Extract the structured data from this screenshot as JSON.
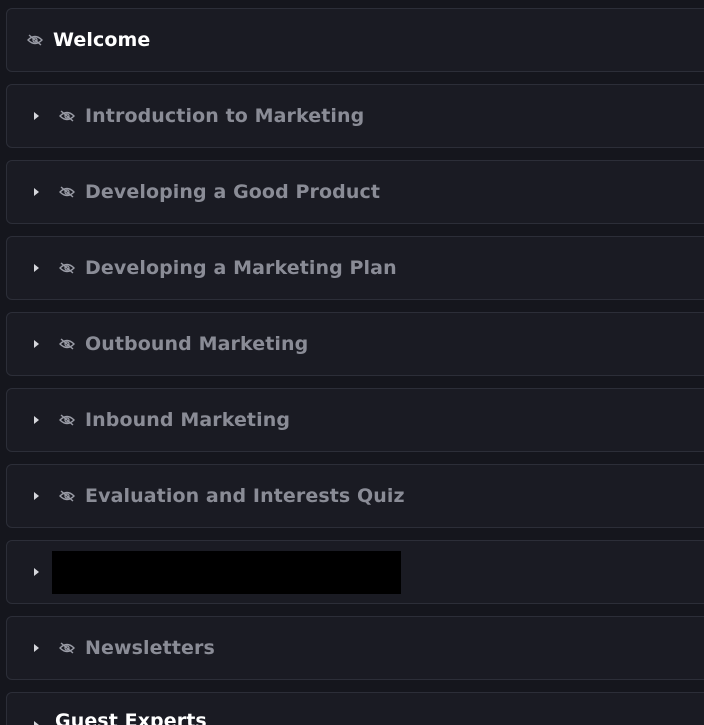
{
  "modules": [
    {
      "label": "Welcome",
      "expandable": false,
      "hidden_icon": true,
      "active": true
    },
    {
      "label": "Introduction to Marketing",
      "expandable": true,
      "hidden_icon": true,
      "active": false
    },
    {
      "label": "Developing a Good Product",
      "expandable": true,
      "hidden_icon": true,
      "active": false
    },
    {
      "label": "Developing a Marketing Plan",
      "expandable": true,
      "hidden_icon": true,
      "active": false
    },
    {
      "label": "Outbound Marketing",
      "expandable": true,
      "hidden_icon": true,
      "active": false
    },
    {
      "label": "Inbound Marketing",
      "expandable": true,
      "hidden_icon": true,
      "active": false
    },
    {
      "label": "Evaluation and Interests Quiz",
      "expandable": true,
      "hidden_icon": true,
      "active": false
    },
    {
      "label": "",
      "expandable": true,
      "hidden_icon": false,
      "active": false,
      "redacted": true
    },
    {
      "label": "Newsletters",
      "expandable": true,
      "hidden_icon": true,
      "active": false
    },
    {
      "label": "Guest Experts",
      "expandable": true,
      "hidden_icon": false,
      "active": true
    }
  ],
  "colors": {
    "background": "#15161d",
    "row_background": "#1a1b23",
    "row_border": "#2c2e38",
    "label_muted": "#8a8c96",
    "label_active": "#ffffff"
  }
}
